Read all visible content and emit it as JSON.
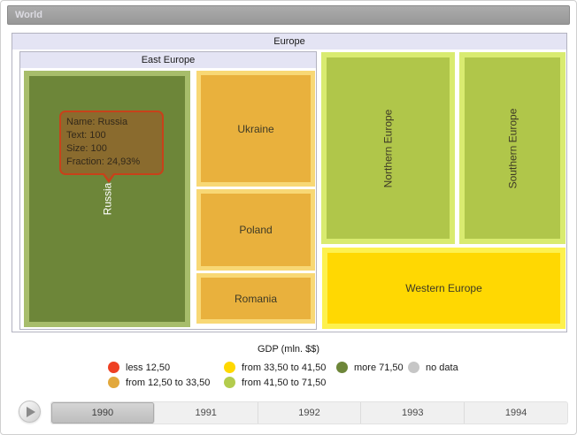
{
  "breadcrumb": {
    "root_label": "World"
  },
  "treemap": {
    "region_label": "Europe",
    "east_group_label": "East Europe",
    "tiles": {
      "russia": {
        "label": "Russia"
      },
      "ukraine": {
        "label": "Ukraine"
      },
      "poland": {
        "label": "Poland"
      },
      "romania": {
        "label": "Romania"
      },
      "northern": {
        "label": "Northern Europe"
      },
      "southern": {
        "label": "Southern Europe"
      },
      "western": {
        "label": "Western Europe"
      }
    },
    "tooltip": {
      "lines": [
        "Name: Russia",
        "Text: 100",
        "Size: 100",
        "Fraction: 24,93%"
      ]
    },
    "colors": {
      "russia_fill": "#6d8639",
      "russia_border": "#a7bd6b",
      "orange_fill": "#e9b13d",
      "orange_border": "#f8d875",
      "green_fill": "#b0c64a",
      "green_border": "#d9eb70",
      "yellow_fill": "#ffd802",
      "yellow_border": "#fdf14f",
      "tooltip_bg": "#8a6b2e",
      "tooltip_border": "#c8411a"
    }
  },
  "legend": {
    "title": "GDP (mln. $$)",
    "items": [
      {
        "label": "less 12,50",
        "color": "#ee4023"
      },
      {
        "label": "from 12,50 to 33,50",
        "color": "#e2a83c"
      },
      {
        "label": "from 33,50 to 41,50",
        "color": "#ffd800"
      },
      {
        "label": "from 41,50 to 71,50",
        "color": "#b3cc4d"
      },
      {
        "label": "more 71,50",
        "color": "#6d8639"
      },
      {
        "label": "no data",
        "color": "#c6c6c6"
      }
    ]
  },
  "timeline": {
    "years": [
      "1990",
      "1991",
      "1992",
      "1993",
      "1994"
    ],
    "selected_year": "1990"
  }
}
